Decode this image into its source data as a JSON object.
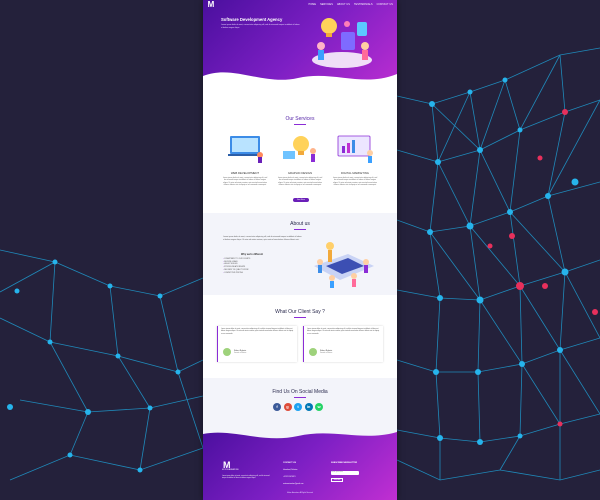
{
  "hero": {
    "logo_letter": "M",
    "nav": [
      "HOME",
      "SERVICES",
      "ABOUT US",
      "TESTIMONIALS",
      "CONTACT US"
    ],
    "title": "Software Development Agency",
    "subtitle": "Lorem ipsum dolor sit amet, consectetur adipiscing elit, sed do eiusmod tempor incididunt ut labore et dolore magna aliqua."
  },
  "services": {
    "title": "Our Services",
    "items": [
      {
        "name": "WEB DEVELOPMENT",
        "text": "Lorem ipsum dolor sit amet, consectetur adipiscing elit, sed do eiusmod tempor incididunt ut labore et dolore magna aliqua. Ut enim ad minim veniam, quis nostrud exercitation ullamco laboris nisi ut aliquip ex ea commodo consequat."
      },
      {
        "name": "GRAPHIC DESIGN",
        "text": "Lorem ipsum dolor sit amet, consectetur adipiscing elit, sed do eiusmod tempor incididunt ut labore et dolore magna aliqua. Ut enim ad minim veniam, quis nostrud exercitation ullamco laboris nisi ut aliquip ex ea commodo consequat."
      },
      {
        "name": "DIGITAL MARKETING",
        "text": "Lorem ipsum dolor sit amet, consectetur adipiscing elit, sed do eiusmod tempor incididunt ut labore et dolore magna aliqua. Ut enim ad minim veniam, quis nostrud exercitation ullamco laboris nisi ut aliquip ex ea commodo consequat."
      }
    ],
    "button": "See More"
  },
  "about": {
    "title": "About us",
    "text": "Lorem ipsum dolor sit amet, consectetur adipiscing elit, sed do eiusmod tempor incididunt ut labore et dolore magna aliqua. Ut enim ad minim veniam, quis nostrud exercitation ullamco laboris nisi.",
    "subtitle": "Why we're different",
    "list": [
      "COMMITMENT TO OUR CLIENTS",
      "SECURE & SAFE",
      "HIGHLY SKILLED",
      "STRONG RELATIONSHIPS",
      "DELIVERY OF QUALITY WORK",
      "COMPETITIVE PRICING"
    ]
  },
  "testimonials": {
    "title": "What Our Client Say ?",
    "items": [
      {
        "text": "Lorem ipsum dolor sit amet, consectetur adipiscing elit, sed do eiusmod tempor incididunt ut labore et dolore magna aliqua. Ut enim ad minim veniam, quis nostrud exercitation ullamco laboris nisi ut aliquip ex ea commodo.",
        "name": "Robert Roberts",
        "role": "Founder of Motion"
      },
      {
        "text": "Lorem ipsum dolor sit amet, consectetur adipiscing elit, sed do eiusmod tempor incididunt ut labore et dolore magna aliqua. Ut enim ad minim veniam, quis nostrud exercitation ullamco laboris nisi ut aliquip ex ea commodo.",
        "name": "Robert Roberts",
        "role": "Founder of Motion"
      }
    ]
  },
  "social": {
    "title": "Find Us On Social Media",
    "icons": [
      {
        "name": "facebook-icon",
        "glyph": "f",
        "color": "#3b5998"
      },
      {
        "name": "google-plus-icon",
        "glyph": "g",
        "color": "#dd4b39"
      },
      {
        "name": "twitter-icon",
        "glyph": "t",
        "color": "#1da1f2"
      },
      {
        "name": "linkedin-icon",
        "glyph": "in",
        "color": "#0077b5"
      },
      {
        "name": "whatsapp-icon",
        "glyph": "w",
        "color": "#25d366"
      }
    ]
  },
  "footer": {
    "logo_letter": "M",
    "logo_sub": "MOTION ANIMATIONS",
    "text": "Lorem ipsum dolor sit amet, consectetur adipiscing elit, sed do eiusmod tempor incididunt ut labore et dolore magna aliqua.",
    "contact_head": "CONTACT US",
    "address": "Islamabad, Pakistan",
    "phone": "+92 321 5673421",
    "email": "motionanimation@gmail.com",
    "newsletter_head": "SUBSCRIBE NEWSLETTER",
    "newsletter_placeholder": "Enter your email",
    "newsletter_button": "Subscribe",
    "copyright": "Motion Animations All Rights Reserved"
  },
  "colors": {
    "brand_purple": "#6a1fb8",
    "brand_magenta": "#c12fd2"
  }
}
